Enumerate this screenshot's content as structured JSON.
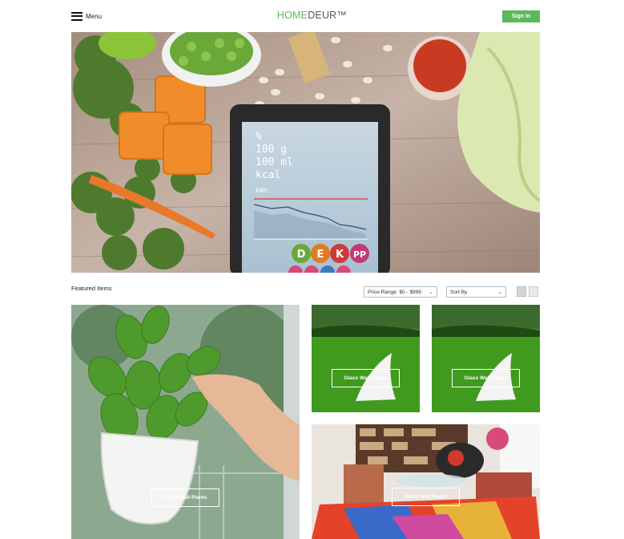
{
  "header": {
    "menu_label": "Menu",
    "logo_part1": "HOME",
    "logo_part2": "DEUR™",
    "signin_label": "Sign In"
  },
  "hero": {
    "tablet_lines": [
      "%",
      "100 g",
      "100 ml",
      "kcal"
    ],
    "chart_label": "kWh",
    "vitamins": [
      "D",
      "E",
      "K",
      "PP"
    ]
  },
  "toolbar": {
    "featured_label": "Featured Items",
    "price_range_value": "Price Range: $0 - $999",
    "sort_value": "Sort By"
  },
  "items": [
    {
      "label": "Glass Wall Plants"
    },
    {
      "label": "Glass Wall Plants"
    },
    {
      "label": "Glass Wall Plants"
    },
    {
      "label": "Glass Wall Plants"
    }
  ],
  "colors": {
    "accent": "#5cb85c",
    "logo_second": "#555555"
  }
}
